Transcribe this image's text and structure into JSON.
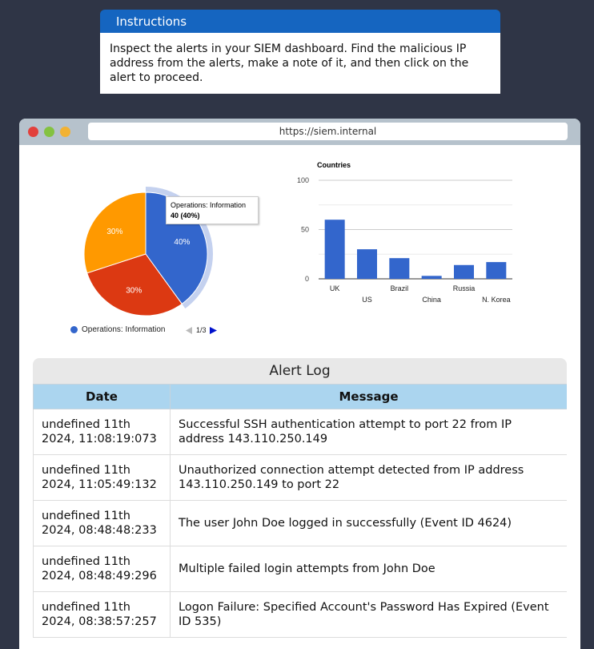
{
  "instructions": {
    "title": "Instructions",
    "text": "Inspect the alerts in your SIEM dashboard. Find the malicious IP address from the alerts, make a note of it, and then click on the alert to proceed."
  },
  "browser": {
    "url": "https://siem.internal"
  },
  "colors": {
    "background": "#2f3546",
    "instructions_header": "#1565c0",
    "pie_blue": "#3366cc",
    "pie_red": "#dc3912",
    "pie_orange": "#ff9900",
    "table_header": "#abd5ef"
  },
  "pie_chart": {
    "chart_data": {
      "type": "pie",
      "slices": [
        {
          "label": "Operations: Information",
          "value": 40,
          "percent_label": "40%",
          "color": "#3366cc"
        },
        {
          "label": "",
          "value": 30,
          "percent_label": "30%",
          "color": "#dc3912"
        },
        {
          "label": "",
          "value": 30,
          "percent_label": "30%",
          "color": "#ff9900"
        }
      ],
      "legend": "bottom",
      "highlighted_slice": 0
    },
    "tooltip": {
      "title": "Operations: Information",
      "value": "40 (40%)"
    },
    "legend_label": "Operations: Information",
    "pager": "1/3"
  },
  "chart_data": {
    "type": "bar",
    "title": "Countries",
    "categories": [
      "UK",
      "US",
      "Brazil",
      "China",
      "Russia",
      "N. Korea"
    ],
    "values": [
      60,
      30,
      21,
      3,
      14,
      17
    ],
    "ylim": [
      0,
      100
    ],
    "yticks": [
      "0",
      "50",
      "100"
    ],
    "grid": true,
    "color": "#3366cc"
  },
  "alert_log": {
    "caption": "Alert Log",
    "columns": [
      "Date",
      "Message"
    ],
    "rows": [
      {
        "date": "undefined 11th 2024, 11:08:19:073",
        "message": "Successful SSH authentication attempt to port 22 from IP address 143.110.250.149"
      },
      {
        "date": "undefined 11th 2024, 11:05:49:132",
        "message": "Unauthorized connection attempt detected from IP address 143.110.250.149 to port 22"
      },
      {
        "date": "undefined 11th 2024, 08:48:48:233",
        "message": "The user John Doe logged in successfully (Event ID 4624)"
      },
      {
        "date": "undefined 11th 2024, 08:48:49:296",
        "message": "Multiple failed login attempts from John Doe"
      },
      {
        "date": "undefined 11th 2024, 08:38:57:257",
        "message": "Logon Failure: Specified Account's Password Has Expired (Event ID 535)"
      }
    ]
  }
}
